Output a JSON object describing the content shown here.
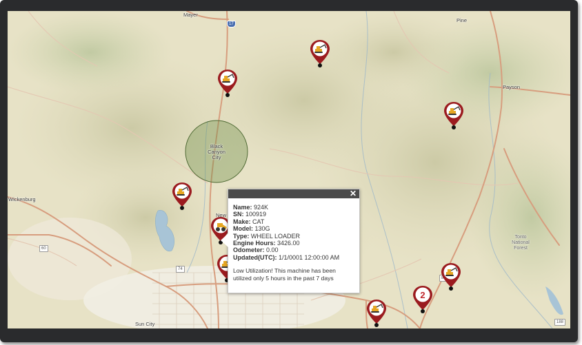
{
  "map": {
    "places": {
      "mayer": "Mayer",
      "pine": "Pine",
      "payson": "Payson",
      "black_canyon_city": "Black Canyon City",
      "wickenburg": "Wickenburg",
      "sun_city": "Sun City",
      "new_river": "New",
      "tonto_national_forest": "Tonto National Forest"
    },
    "shields": {
      "i17": "17",
      "us60": "60",
      "r74": "74",
      "r87": "87",
      "r188": "188"
    },
    "cluster_count": "2"
  },
  "markers": [
    {
      "icon": "excavator-icon"
    },
    {
      "icon": "excavator-icon"
    },
    {
      "icon": "excavator-icon"
    },
    {
      "icon": "excavator-icon"
    },
    {
      "icon": "wheel-loader-icon"
    },
    {
      "icon": "excavator-icon"
    },
    {
      "icon": "excavator-icon"
    },
    {
      "icon": "excavator-icon"
    }
  ],
  "popup": {
    "close_label": "✕",
    "fields": [
      {
        "label": "Name:",
        "value": "924K"
      },
      {
        "label": "SN:",
        "value": "100919"
      },
      {
        "label": "Make:",
        "value": "CAT"
      },
      {
        "label": "Model:",
        "value": "130G"
      },
      {
        "label": "Type:",
        "value": "WHEEL LOADER"
      },
      {
        "label": "Engine Hours:",
        "value": "3426.00"
      },
      {
        "label": "Odometer:",
        "value": "0.00"
      },
      {
        "label": "Updated(UTC):",
        "value": "1/1/0001 12:00:00 AM"
      }
    ],
    "note": "Low Utilization! This machine has been utilized only 5 hours in the past 7 days"
  },
  "colors": {
    "marker": "#9b1b1f",
    "popup_header": "#4b4b4b",
    "road_major": "#d79d7e",
    "circle_fill": "#6f8d4a"
  }
}
